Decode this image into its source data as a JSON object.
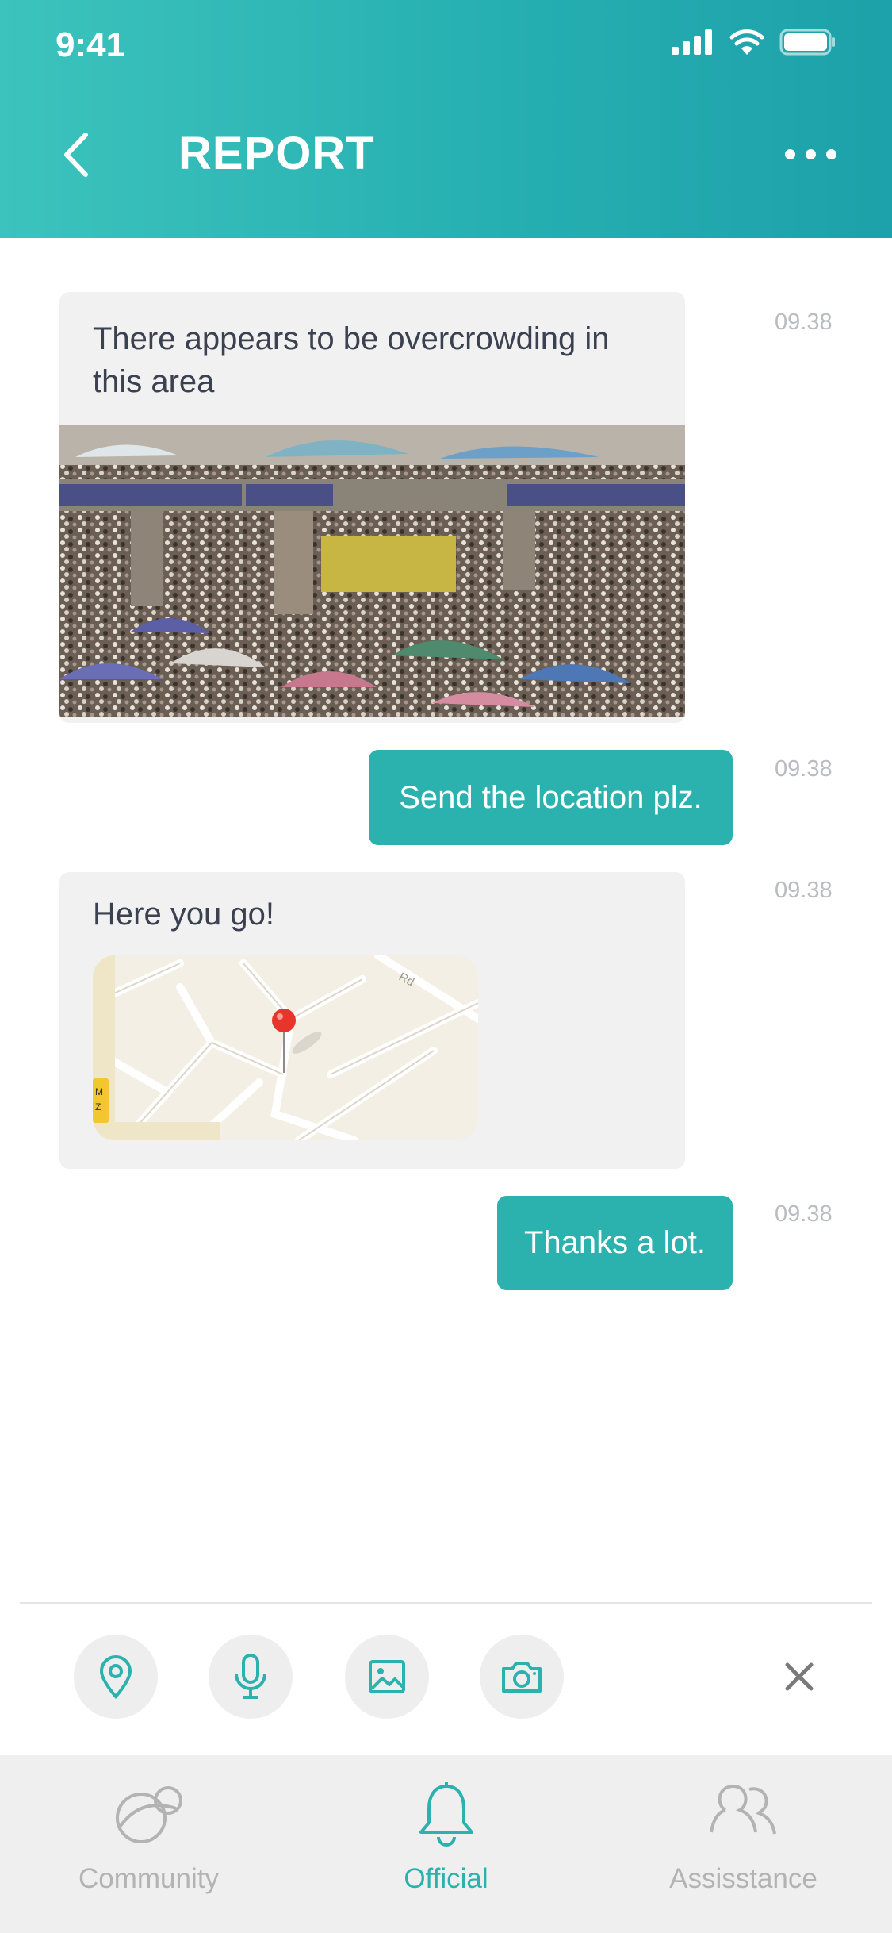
{
  "status_bar": {
    "time": "9:41"
  },
  "header": {
    "title": "REPORT"
  },
  "messages": [
    {
      "text": "There appears to be overcrowding in this area",
      "time": "09.38"
    },
    {
      "text": "Send the location plz.",
      "time": "09.38"
    },
    {
      "text": "Here you go!",
      "time": "09.38"
    },
    {
      "text": "Thanks a lot.",
      "time": "09.38"
    }
  ],
  "map": {
    "road_label": "Rd"
  },
  "toolbar": {
    "icons": [
      "location-pin-icon",
      "microphone-icon",
      "image-icon",
      "camera-icon",
      "close-icon"
    ]
  },
  "tabbar": {
    "tabs": [
      {
        "label": "Community",
        "active": false
      },
      {
        "label": "Official",
        "active": true
      },
      {
        "label": "Assisstance",
        "active": false
      }
    ]
  },
  "colors": {
    "accent": "#2bb2ae",
    "header_start": "#3cc3bd",
    "header_end": "#1da1aa"
  }
}
